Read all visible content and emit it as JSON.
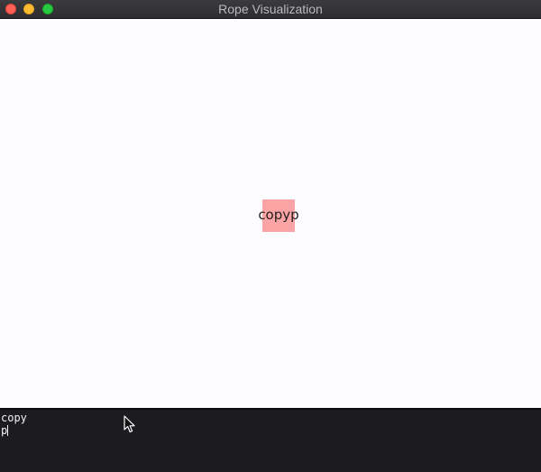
{
  "window": {
    "title": "Rope Visualization",
    "controls": [
      "close",
      "minimize",
      "zoom"
    ]
  },
  "canvas": {
    "background": "#fdfcfe",
    "nodes": [
      {
        "label": "copyp",
        "color": "#fca3a5"
      }
    ]
  },
  "terminal": {
    "background": "#1c1b1f",
    "lines": [
      "copy",
      "p"
    ]
  },
  "icons": {
    "mouse_pointer": "arrow-cursor-icon"
  }
}
